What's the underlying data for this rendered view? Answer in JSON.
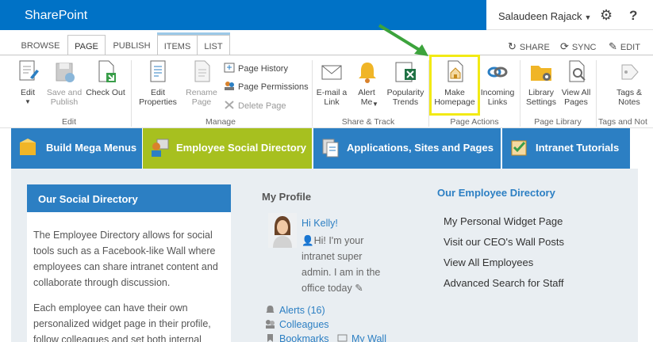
{
  "suite": {
    "brand": "SharePoint",
    "user": "Salaudeen Rajack",
    "settings_icon": "gear-icon",
    "help": "?"
  },
  "tabs": [
    {
      "label": "BROWSE"
    },
    {
      "label": "PAGE"
    },
    {
      "label": "PUBLISH"
    },
    {
      "label": "ITEMS"
    },
    {
      "label": "LIST"
    }
  ],
  "ribbon_actions": {
    "share": "SHARE",
    "sync": "SYNC",
    "edit": "EDIT"
  },
  "ribbon": {
    "edit": "Edit",
    "save_publish": "Save and Publish",
    "check_out": "Check Out",
    "edit_properties": "Edit Properties",
    "rename_page": "Rename Page",
    "page_history": "Page History",
    "page_permissions": "Page Permissions",
    "delete_page": "Delete Page",
    "email_link": "E-mail a Link",
    "alert_me": "Alert Me",
    "popularity_trends": "Popularity Trends",
    "make_homepage": "Make Homepage",
    "incoming_links": "Incoming Links",
    "library_settings": "Library Settings",
    "view_all_pages": "View All Pages",
    "tags_notes": "Tags & Notes"
  },
  "groups": {
    "edit": "Edit",
    "manage": "Manage",
    "share_track": "Share & Track",
    "page_actions": "Page Actions",
    "page_library": "Page Library",
    "tags_notes": "Tags and Not"
  },
  "mega_menu": [
    {
      "label": "Build Mega Menus"
    },
    {
      "label": "Employee Social Directory"
    },
    {
      "label": "Applications, Sites and Pages"
    },
    {
      "label": "Intranet Tutorials"
    }
  ],
  "card": {
    "title": "Our Social Directory",
    "p1": "The Employee Directory allows for social tools such as a Facebook-like Wall where employees can share intranet content and collaborate through discussion.",
    "p2": "Each employee can have their own personalized widget page in their profile, follow colleagues and set both internal"
  },
  "profile": {
    "title": "My Profile",
    "greeting": "Hi Kelly!",
    "status_lines": [
      "Hi! I'm your",
      "intranet super",
      "admin. I am in the",
      "office today"
    ],
    "links": {
      "alerts": "Alerts (16)",
      "colleagues": "Colleagues",
      "bookmarks": "Bookmarks",
      "my_wall": "My Wall"
    }
  },
  "directory": {
    "title": "Our Employee Directory",
    "items": [
      "My Personal Widget Page",
      "Visit our CEO's Wall Posts",
      "View All Employees",
      "Advanced Search for Staff"
    ]
  },
  "colors": {
    "brand_blue": "#0072c6",
    "nav_blue": "#2c7fc3",
    "nav_active": "#a7c01f",
    "highlight": "#f2ea15",
    "arrow": "#3ca33c"
  }
}
